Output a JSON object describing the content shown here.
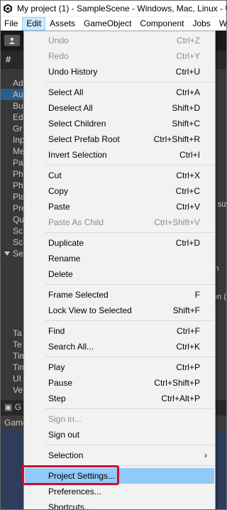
{
  "window": {
    "title": "My project (1) - SampleScene - Windows, Mac, Linux - Unity"
  },
  "menubar": {
    "items": [
      "File",
      "Edit",
      "Assets",
      "GameObject",
      "Component",
      "Jobs",
      "Window"
    ],
    "active": "Edit"
  },
  "background": {
    "list_fragments": [
      "Ad",
      "Au",
      "Bu",
      "Ed",
      "Gr",
      "Inp",
      "Me",
      "Pa",
      "Ph",
      "Ph",
      "Pla",
      "Pre",
      "Qu",
      "Sc",
      "Sc",
      "Se",
      "Ta",
      "Te",
      "Tim",
      "Tin",
      "UI",
      "Ve"
    ],
    "right_fragments": [
      "r siz",
      "in",
      "on (",
      "l"
    ],
    "game_tab": "G",
    "game_label": "Game"
  },
  "edit_menu": {
    "undo": {
      "label": "Undo",
      "shortcut": "Ctrl+Z"
    },
    "redo": {
      "label": "Redo",
      "shortcut": "Ctrl+Y"
    },
    "undo_history": {
      "label": "Undo History",
      "shortcut": "Ctrl+U"
    },
    "select_all": {
      "label": "Select All",
      "shortcut": "Ctrl+A"
    },
    "deselect_all": {
      "label": "Deselect All",
      "shortcut": "Shift+D"
    },
    "select_children": {
      "label": "Select Children",
      "shortcut": "Shift+C"
    },
    "select_prefab_root": {
      "label": "Select Prefab Root",
      "shortcut": "Ctrl+Shift+R"
    },
    "invert_selection": {
      "label": "Invert Selection",
      "shortcut": "Ctrl+I"
    },
    "cut": {
      "label": "Cut",
      "shortcut": "Ctrl+X"
    },
    "copy": {
      "label": "Copy",
      "shortcut": "Ctrl+C"
    },
    "paste": {
      "label": "Paste",
      "shortcut": "Ctrl+V"
    },
    "paste_as_child": {
      "label": "Paste As Child",
      "shortcut": "Ctrl+Shift+V"
    },
    "duplicate": {
      "label": "Duplicate",
      "shortcut": "Ctrl+D"
    },
    "rename": {
      "label": "Rename",
      "shortcut": ""
    },
    "delete": {
      "label": "Delete",
      "shortcut": ""
    },
    "frame_selected": {
      "label": "Frame Selected",
      "shortcut": "F"
    },
    "lock_view": {
      "label": "Lock View to Selected",
      "shortcut": "Shift+F"
    },
    "find": {
      "label": "Find",
      "shortcut": "Ctrl+F"
    },
    "search_all": {
      "label": "Search All...",
      "shortcut": "Ctrl+K"
    },
    "play": {
      "label": "Play",
      "shortcut": "Ctrl+P"
    },
    "pause": {
      "label": "Pause",
      "shortcut": "Ctrl+Shift+P"
    },
    "step": {
      "label": "Step",
      "shortcut": "Ctrl+Alt+P"
    },
    "sign_in": {
      "label": "Sign in...",
      "shortcut": ""
    },
    "sign_out": {
      "label": "Sign out",
      "shortcut": ""
    },
    "selection": {
      "label": "Selection",
      "submenu_arrow": "›"
    },
    "project_settings": {
      "label": "Project Settings...",
      "shortcut": ""
    },
    "preferences": {
      "label": "Preferences...",
      "shortcut": ""
    },
    "shortcuts": {
      "label": "Shortcuts...",
      "shortcut": ""
    }
  },
  "colors": {
    "highlight": "#91c9f7",
    "callout": "#c8102e",
    "editor_bg": "#383838"
  }
}
